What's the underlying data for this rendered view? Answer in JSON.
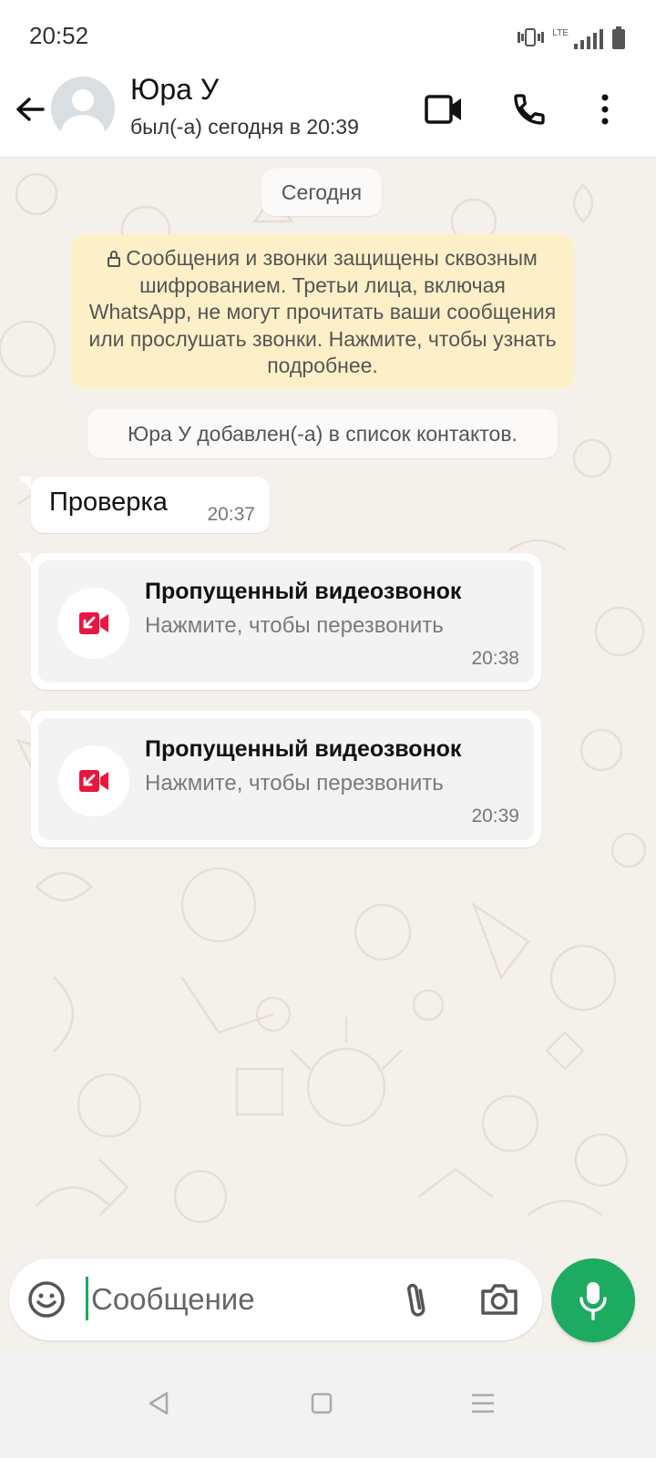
{
  "status_bar": {
    "time": "20:52",
    "network": "LTE"
  },
  "header": {
    "contact_name": "Юра У",
    "last_seen": "был(-а) сегодня в 20:39"
  },
  "chat": {
    "date_label": "Сегодня",
    "encryption_notice": "Сообщения и звонки защищены сквозным шифрованием. Третьи лица, включая WhatsApp, не могут прочитать ваши сообщения или прослушать звонки. Нажмите, чтобы узнать подробнее.",
    "system_message": "Юра У добавлен(-а) в список контактов.",
    "messages": [
      {
        "text": "Проверка",
        "time": "20:37"
      }
    ],
    "missed_calls": [
      {
        "title": "Пропущенный видеозвонок",
        "subtitle": "Нажмите, чтобы перезвонить",
        "time": "20:38"
      },
      {
        "title": "Пропущенный видеозвонок",
        "subtitle": "Нажмите, чтобы перезвонить",
        "time": "20:39"
      }
    ]
  },
  "composer": {
    "placeholder": "Сообщение"
  },
  "icons": {
    "back": "arrow-left-icon",
    "video": "video-camera-icon",
    "call": "phone-icon",
    "menu": "more-vertical-icon",
    "emoji": "emoji-icon",
    "attach": "paperclip-icon",
    "camera": "camera-icon",
    "mic": "microphone-icon",
    "missed_video": "missed-video-call-icon"
  },
  "colors": {
    "accent": "#1daa61",
    "missed": "#e8173f",
    "notice_bg": "#fdf0c8",
    "chat_bg": "#f4f1ec"
  }
}
